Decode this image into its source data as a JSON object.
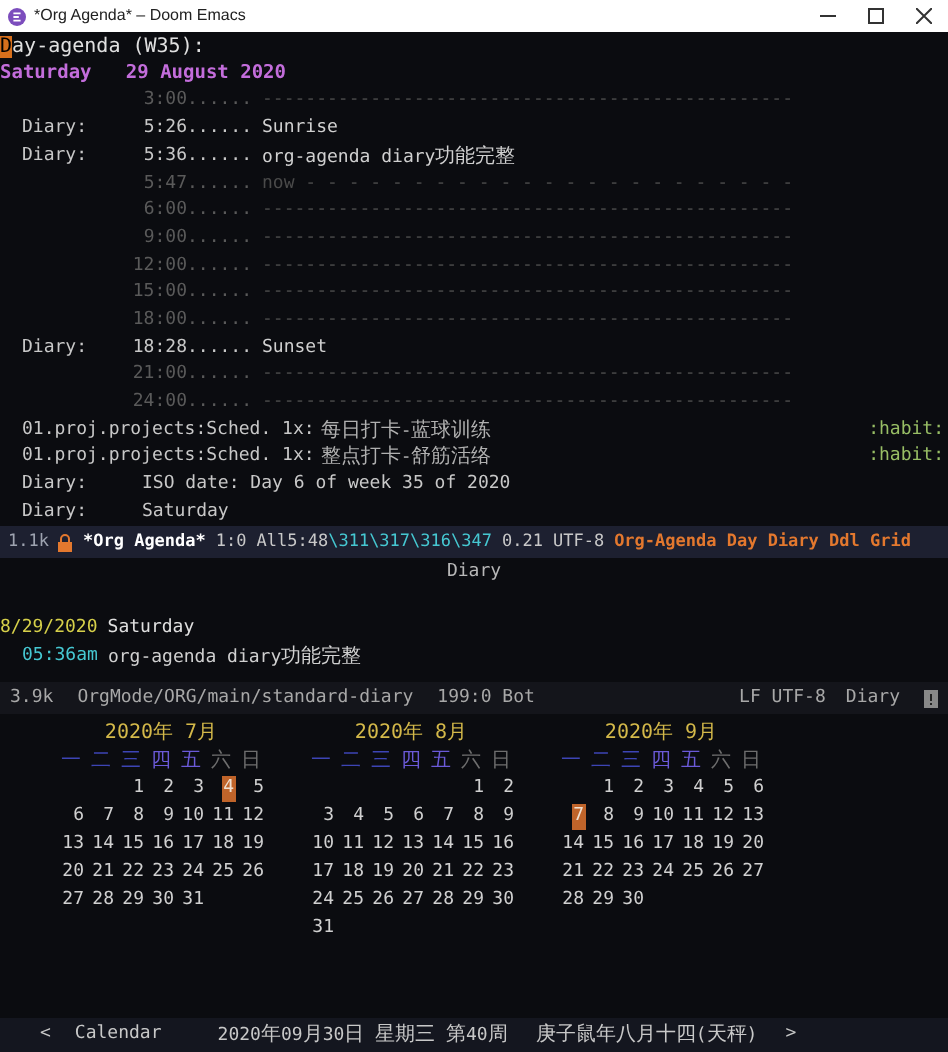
{
  "window": {
    "title": "*Org Agenda* – Doom Emacs"
  },
  "agenda": {
    "heading": "Day-agenda (W35):",
    "cursor_at_start": true,
    "date": "Saturday   29 August 2020",
    "lines": [
      {
        "kind": "grid",
        "time": "3:00......",
        "text": "-------------------------------------------------"
      },
      {
        "kind": "entry",
        "category": "Diary:",
        "time": "5:26......",
        "text": "Sunrise"
      },
      {
        "kind": "entry",
        "category": "Diary:",
        "time": "5:36......",
        "text": "org-agenda diary功能完整"
      },
      {
        "kind": "now",
        "time": "5:47......",
        "text": "now - - - - - - - - - - - - - - - - - - - - - - -"
      },
      {
        "kind": "grid",
        "time": "6:00......",
        "text": "-------------------------------------------------"
      },
      {
        "kind": "grid",
        "time": "9:00......",
        "text": "-------------------------------------------------"
      },
      {
        "kind": "grid",
        "time": "12:00......",
        "text": "-------------------------------------------------"
      },
      {
        "kind": "grid",
        "time": "15:00......",
        "text": "-------------------------------------------------"
      },
      {
        "kind": "grid",
        "time": "18:00......",
        "text": "-------------------------------------------------"
      },
      {
        "kind": "entry",
        "category": "Diary:",
        "time": "18:28......",
        "text": "Sunset"
      },
      {
        "kind": "grid",
        "time": "21:00......",
        "text": "-------------------------------------------------"
      },
      {
        "kind": "grid",
        "time": "24:00......",
        "text": "-------------------------------------------------"
      },
      {
        "kind": "habit",
        "category": "01.proj.projects:Sched. 1x:",
        "text": "每日打卡-蓝球训练",
        "tag": ":habit:"
      },
      {
        "kind": "habit",
        "category": "01.proj.projects:Sched. 1x:",
        "text": "整点打卡-舒筋活络",
        "tag": ":habit:"
      },
      {
        "kind": "plain",
        "category": "Diary:",
        "text": "ISO date: Day 6 of week 35 of 2020"
      },
      {
        "kind": "plain",
        "category": "Diary:",
        "text": "Saturday"
      }
    ]
  },
  "modeline_1": [
    {
      "kind": "text",
      "text": "1.1k",
      "color": "#9ea3b0"
    },
    {
      "kind": "lock"
    },
    {
      "kind": "text",
      "text": "*Org Agenda*",
      "color": "#ffffff",
      "bold": true
    },
    {
      "kind": "text",
      "text": "1:0",
      "color": "#c8c8c8"
    },
    {
      "kind": "joined",
      "parts": [
        {
          "text": "All5:48",
          "color": "#c8c8c8"
        },
        {
          "text": "\\311\\317\\316\\347",
          "color": "#46c8d2"
        }
      ]
    },
    {
      "kind": "text",
      "text": "0.21",
      "color": "#c8c8c8"
    },
    {
      "kind": "text",
      "text": "UTF-8",
      "color": "#c8c8c8"
    },
    {
      "kind": "text",
      "text": "Org-Agenda Day Diary Ddl Grid",
      "color": "#e3782e",
      "bold": true
    }
  ],
  "diary": {
    "header": "Diary",
    "date": "8/29/2020",
    "day": "Saturday",
    "time": "05:36am",
    "text": "org-agenda diary功能完整"
  },
  "modeline_2": {
    "left": [
      "3.9k",
      "OrgMode/ORG/main/standard-diary",
      "199:0 Bot"
    ],
    "right": [
      "LF UTF-8",
      "Diary"
    ]
  },
  "calendar": {
    "months": [
      {
        "title": "2020年 7月",
        "weekdays": [
          {
            "label": "一",
            "color": "#3d45b5"
          },
          {
            "label": "二",
            "color": "#3d45b5"
          },
          {
            "label": "三",
            "color": "#3d45b5"
          },
          {
            "label": "四",
            "color": "#6b5ad8"
          },
          {
            "label": "五",
            "color": "#6b5ad8"
          },
          {
            "label": "六",
            "color": "#6e6e6e"
          },
          {
            "label": "日",
            "color": "#6e6e6e"
          }
        ],
        "weeks": [
          [
            {
              "day": "1",
              "selected": false
            },
            {
              "day": "2",
              "selected": false
            },
            {
              "day": "3",
              "selected": false
            },
            {
              "day": "4",
              "selected": true
            },
            {
              "day": "5",
              "selected": false
            }
          ],
          [
            {
              "day": "6",
              "selected": false
            },
            {
              "day": "7",
              "selected": false
            },
            {
              "day": "8",
              "selected": false
            },
            {
              "day": "9",
              "selected": false
            },
            {
              "day": "10",
              "selected": false
            },
            {
              "day": "11",
              "selected": false
            },
            {
              "day": "12",
              "selected": false
            }
          ],
          [
            {
              "day": "13",
              "selected": false
            },
            {
              "day": "14",
              "selected": false
            },
            {
              "day": "15",
              "selected": false
            },
            {
              "day": "16",
              "selected": false
            },
            {
              "day": "17",
              "selected": false
            },
            {
              "day": "18",
              "selected": false
            },
            {
              "day": "19",
              "selected": false
            }
          ],
          [
            {
              "day": "20",
              "selected": false
            },
            {
              "day": "21",
              "selected": false
            },
            {
              "day": "22",
              "selected": false
            },
            {
              "day": "23",
              "selected": false
            },
            {
              "day": "24",
              "selected": false
            },
            {
              "day": "25",
              "selected": false
            },
            {
              "day": "26",
              "selected": false
            }
          ],
          [
            {
              "day": "27",
              "selected": false
            },
            {
              "day": "28",
              "selected": false
            },
            {
              "day": "29",
              "selected": false
            },
            {
              "day": "30",
              "selected": false
            },
            {
              "day": "31",
              "selected": false
            }
          ]
        ]
      },
      {
        "title": "2020年 8月",
        "weekdays": [
          {
            "label": "一",
            "color": "#3d45b5"
          },
          {
            "label": "二",
            "color": "#3d45b5"
          },
          {
            "label": "三",
            "color": "#3d45b5"
          },
          {
            "label": "四",
            "color": "#6b5ad8"
          },
          {
            "label": "五",
            "color": "#6b5ad8"
          },
          {
            "label": "六",
            "color": "#6e6e6e"
          },
          {
            "label": "日",
            "color": "#6e6e6e"
          }
        ],
        "weeks": [
          [
            {
              "day": "1",
              "selected": false
            },
            {
              "day": "2",
              "selected": false
            }
          ],
          [
            {
              "day": "3",
              "selected": false
            },
            {
              "day": "4",
              "selected": false
            },
            {
              "day": "5",
              "selected": false
            },
            {
              "day": "6",
              "selected": false
            },
            {
              "day": "7",
              "selected": false
            },
            {
              "day": "8",
              "selected": false
            },
            {
              "day": "9",
              "selected": false
            }
          ],
          [
            {
              "day": "10",
              "selected": false
            },
            {
              "day": "11",
              "selected": false
            },
            {
              "day": "12",
              "selected": false
            },
            {
              "day": "13",
              "selected": false
            },
            {
              "day": "14",
              "selected": false
            },
            {
              "day": "15",
              "selected": false
            },
            {
              "day": "16",
              "selected": false
            }
          ],
          [
            {
              "day": "17",
              "selected": false
            },
            {
              "day": "18",
              "selected": false
            },
            {
              "day": "19",
              "selected": false
            },
            {
              "day": "20",
              "selected": false
            },
            {
              "day": "21",
              "selected": false
            },
            {
              "day": "22",
              "selected": false
            },
            {
              "day": "23",
              "selected": false
            }
          ],
          [
            {
              "day": "24",
              "selected": false
            },
            {
              "day": "25",
              "selected": false
            },
            {
              "day": "26",
              "selected": false
            },
            {
              "day": "27",
              "selected": false
            },
            {
              "day": "28",
              "selected": false
            },
            {
              "day": "29",
              "selected": false
            },
            {
              "day": "30",
              "selected": false
            }
          ],
          [
            {
              "day": "31",
              "selected": false
            }
          ]
        ]
      },
      {
        "title": "2020年 9月",
        "weekdays": [
          {
            "label": "一",
            "color": "#3d45b5"
          },
          {
            "label": "二",
            "color": "#3d45b5"
          },
          {
            "label": "三",
            "color": "#3d45b5"
          },
          {
            "label": "四",
            "color": "#6b5ad8"
          },
          {
            "label": "五",
            "color": "#6b5ad8"
          },
          {
            "label": "六",
            "color": "#6e6e6e"
          },
          {
            "label": "日",
            "color": "#6e6e6e"
          }
        ],
        "weeks": [
          [
            {
              "day": "1",
              "selected": false
            },
            {
              "day": "2",
              "selected": false
            },
            {
              "day": "3",
              "selected": false
            },
            {
              "day": "4",
              "selected": false
            },
            {
              "day": "5",
              "selected": false
            },
            {
              "day": "6",
              "selected": false
            }
          ],
          [
            {
              "day": "7",
              "selected": true
            },
            {
              "day": "8",
              "selected": false
            },
            {
              "day": "9",
              "selected": false
            },
            {
              "day": "10",
              "selected": false
            },
            {
              "day": "11",
              "selected": false
            },
            {
              "day": "12",
              "selected": false
            },
            {
              "day": "13",
              "selected": false
            }
          ],
          [
            {
              "day": "14",
              "selected": false
            },
            {
              "day": "15",
              "selected": false
            },
            {
              "day": "16",
              "selected": false
            },
            {
              "day": "17",
              "selected": false
            },
            {
              "day": "18",
              "selected": false
            },
            {
              "day": "19",
              "selected": false
            },
            {
              "day": "20",
              "selected": false
            }
          ],
          [
            {
              "day": "21",
              "selected": false
            },
            {
              "day": "22",
              "selected": false
            },
            {
              "day": "23",
              "selected": false
            },
            {
              "day": "24",
              "selected": false
            },
            {
              "day": "25",
              "selected": false
            },
            {
              "day": "26",
              "selected": false
            },
            {
              "day": "27",
              "selected": false
            }
          ],
          [
            {
              "day": "28",
              "selected": false
            },
            {
              "day": "29",
              "selected": false
            },
            {
              "day": "30",
              "selected": false
            }
          ]
        ]
      }
    ]
  },
  "footer": {
    "prev": "<",
    "name": "Calendar",
    "date": "2020年09月30日 星期三 第40周",
    "lunar": "庚子鼠年八月十四(天秤)",
    "next": ">"
  }
}
